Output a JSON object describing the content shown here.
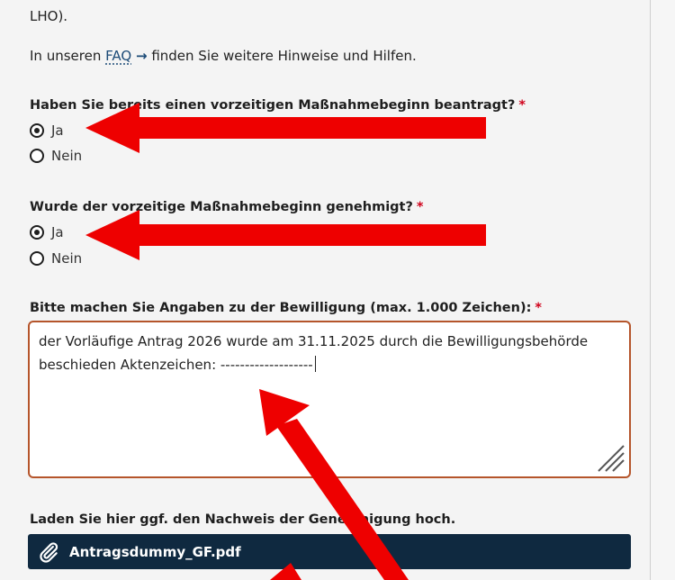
{
  "intro": {
    "lho_text": "LHO).",
    "faq_prefix": "In unseren",
    "faq_link": "FAQ",
    "faq_arrow": "→",
    "faq_suffix": "finden Sie weitere Hinweise und Hilfen."
  },
  "question1": {
    "label": "Haben Sie bereits einen vorzeitigen Maßnahmebeginn beantragt?",
    "required_mark": "*",
    "options": [
      {
        "label": "Ja",
        "checked": true
      },
      {
        "label": "Nein",
        "checked": false
      }
    ]
  },
  "question2": {
    "label": "Wurde der vorzeitige Maßnahmebeginn genehmigt?",
    "required_mark": "*",
    "options": [
      {
        "label": "Ja",
        "checked": true
      },
      {
        "label": "Nein",
        "checked": false
      }
    ]
  },
  "question3": {
    "label": "Bitte machen Sie Angaben zu der Bewilligung (max. 1.000 Zeichen):",
    "required_mark": "*",
    "value_line1": "der Vorläufige Antrag 2026 wurde am 31.11.2025 durch die Bewilligungsbehörde",
    "value_line2": "beschieden Aktenzeichen: -------------------"
  },
  "upload": {
    "label": "Laden Sie hier ggf. den Nachweis der Genehmigung hoch.",
    "file_name": "Antragsdummy_GF.pdf"
  },
  "colors": {
    "accent": "#1c4b78",
    "required": "#d0021b",
    "textarea_border": "#b5552b",
    "upload_bg": "#0f2940",
    "annotation_arrow": "#ee0000"
  },
  "icons": {
    "faq_arrow": "arrow-right-icon",
    "upload": "paperclip-icon",
    "resize": "resize-handle-icon"
  }
}
